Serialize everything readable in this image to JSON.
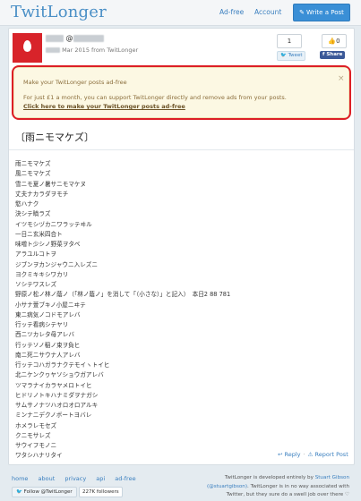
{
  "nav": {
    "logo": "TwitLonger",
    "links": [
      "Ad-free",
      "Account"
    ],
    "write_button": "Write a Post",
    "write_icon": "pencil-icon"
  },
  "post_header": {
    "at": "@",
    "meta": "Mar 2015 from TwitLonger",
    "like_count": "1",
    "tweet_label": "Tweet",
    "fb_count": "0",
    "fb_label": "Share"
  },
  "ad": {
    "title": "Make your TwitLonger posts ad-free",
    "body": "For just £1 a month, you can support TwitLonger directly and remove ads from your posts.",
    "link": "Click here to make your TwitLonger posts ad-free",
    "close": "×"
  },
  "post": {
    "title": "〔雨ニモマケズ〕",
    "lines": [
      "雨ニモマケズ",
      "風ニモマケズ",
      "雪ニモ夏ノ暑サニモマケヌ",
      "丈夫ナカラダヲモチ",
      "慾ハナク",
      "決シテ瞋ラズ",
      "イツモシヅカニワラッテヰル",
      "一日ニ玄米四合ト",
      "味噌ト少シノ野菜ヲタベ",
      "アラユルコトヲ",
      "ジブンヲカンジャウニ入レズニ",
      "ヨクミキキシワカリ",
      "ソシテワスレズ",
      "野原ノ松ノ林ノ蔭ノ（「林ノ蔭ノ」を消して「（小さな）」と記入）　本日2 88 781",
      "小サナ萱ブキノ小屋ニヰテ",
      "東ニ病気ノコドモアレバ",
      "行ッテ看病シテヤリ",
      "西ニツカレタ母アレバ",
      "行ッテソノ稲ノ束ヲ負ヒ",
      "南ニ死ニサウナ人アレバ",
      "行ッテコハガラナクテモイヽトイヒ",
      "北ニケンクヮヤソショウガアレバ",
      "ツマラナイカラヤメロトイヒ",
      "ヒドリノトキハナミダヲナガシ",
      "サムサノナツハオロオロアルキ",
      "ミンナニデクノボートヨバレ",
      "ホメラレモセズ",
      "クニモサレズ",
      "サウイフモノニ",
      "ワタシハナリタイ"
    ],
    "reply": "Reply",
    "report": "Report Post",
    "reply_icon": "reply-icon",
    "report_icon": "warning-icon"
  },
  "footer": {
    "links": [
      "home",
      "about",
      "privacy",
      "api",
      "ad-free"
    ],
    "follow_label": "Follow @TwitLonger",
    "followers": "227K followers",
    "credit_1": "TwitLonger is developed entirely by",
    "credit_name": "Stuart Gibson",
    "credit_handle": "(@stuartgibson)",
    "credit_2": ". TwitLonger is in no way associated with",
    "credit_3": "Twitter, but they sure do a swell job over there ♡"
  }
}
